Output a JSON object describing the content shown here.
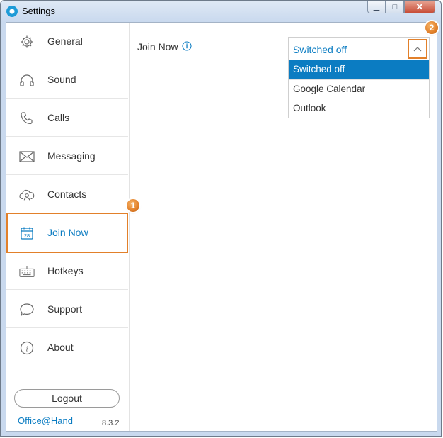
{
  "window": {
    "title": "Settings",
    "controls": {
      "minimize": "▁",
      "maximize": "□",
      "close": "✕"
    }
  },
  "sidebar": {
    "items": [
      {
        "label": "General",
        "icon": "gear-icon"
      },
      {
        "label": "Sound",
        "icon": "headphones-icon"
      },
      {
        "label": "Calls",
        "icon": "phone-icon"
      },
      {
        "label": "Messaging",
        "icon": "envelope-icon"
      },
      {
        "label": "Contacts",
        "icon": "cloud-contacts-icon"
      },
      {
        "label": "Join Now",
        "icon": "calendar-icon",
        "active": true
      },
      {
        "label": "Hotkeys",
        "icon": "keyboard-icon"
      },
      {
        "label": "Support",
        "icon": "chat-bubble-icon"
      },
      {
        "label": "About",
        "icon": "info-icon"
      }
    ],
    "logout_label": "Logout",
    "brand": "Office@Hand",
    "version": "8.3.2"
  },
  "main": {
    "setting_label": "Join Now",
    "select": {
      "value": "Switched off",
      "options": [
        "Switched off",
        "Google Calendar",
        "Outlook"
      ],
      "selected_index": 0
    }
  },
  "annotations": {
    "badge_1": "1",
    "badge_2": "2"
  },
  "colors": {
    "accent": "#0b7cc2",
    "highlight": "#e2802a",
    "text": "#333333"
  }
}
